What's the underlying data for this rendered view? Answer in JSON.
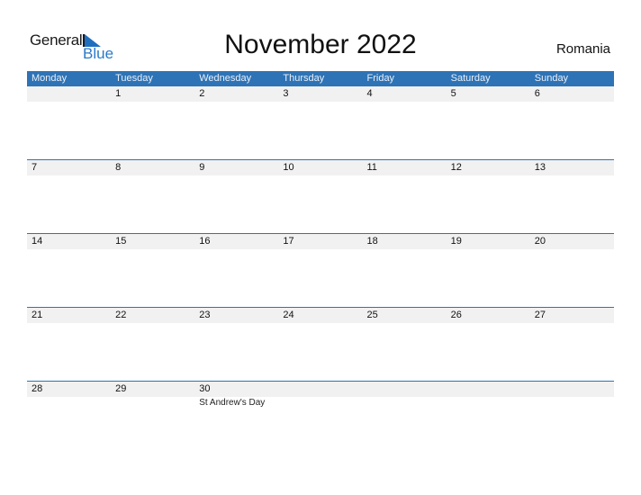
{
  "logo": {
    "line1": "General",
    "line2": "Blue",
    "icon": "triangle-flag-icon"
  },
  "title": "November 2022",
  "country": "Romania",
  "colors": {
    "header_bg": "#2e73b5",
    "strip_bg": "#f1f1f1",
    "brand_blue": "#2a7ac8"
  },
  "weekdays": [
    "Monday",
    "Tuesday",
    "Wednesday",
    "Thursday",
    "Friday",
    "Saturday",
    "Sunday"
  ],
  "weeks": [
    {
      "days": [
        "",
        "1",
        "2",
        "3",
        "4",
        "5",
        "6"
      ],
      "holidays": [
        "",
        "",
        "",
        "",
        "",
        "",
        ""
      ]
    },
    {
      "days": [
        "7",
        "8",
        "9",
        "10",
        "11",
        "12",
        "13"
      ],
      "holidays": [
        "",
        "",
        "",
        "",
        "",
        "",
        ""
      ]
    },
    {
      "days": [
        "14",
        "15",
        "16",
        "17",
        "18",
        "19",
        "20"
      ],
      "holidays": [
        "",
        "",
        "",
        "",
        "",
        "",
        ""
      ]
    },
    {
      "days": [
        "21",
        "22",
        "23",
        "24",
        "25",
        "26",
        "27"
      ],
      "holidays": [
        "",
        "",
        "",
        "",
        "",
        "",
        ""
      ]
    },
    {
      "days": [
        "28",
        "29",
        "30",
        "",
        "",
        "",
        ""
      ],
      "holidays": [
        "",
        "",
        "St Andrew's Day",
        "",
        "",
        "",
        ""
      ]
    }
  ]
}
